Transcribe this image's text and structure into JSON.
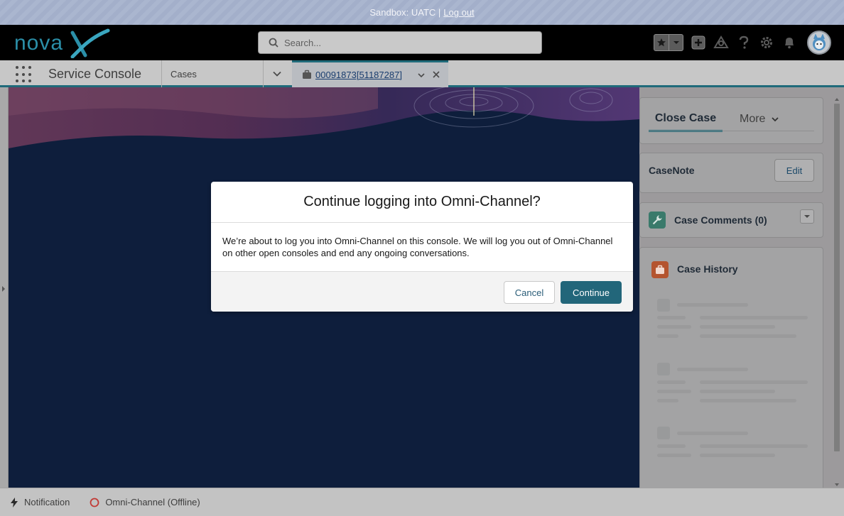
{
  "sandbox_bar": {
    "text": "Sandbox: UATC |",
    "logout_label": "Log out"
  },
  "header": {
    "logo_text": "nova",
    "logo_accent": "X",
    "search_placeholder": "Search...",
    "icons": [
      "star-icon",
      "chevron-down-icon",
      "plus-icon",
      "trailhead-icon",
      "help-icon",
      "gear-icon",
      "bell-icon",
      "avatar"
    ]
  },
  "nav": {
    "app_name": "Service Console",
    "object_label": "Cases",
    "tab_label": "00091873[51187287]"
  },
  "right_panel": {
    "tabs": {
      "active": "Close Case",
      "more": "More"
    },
    "case_note": {
      "title": "CaseNote",
      "edit_label": "Edit"
    },
    "case_comments": {
      "title": "Case Comments (0)"
    },
    "case_history": {
      "title": "Case History"
    }
  },
  "utility_bar": {
    "notification_label": "Notification",
    "omni_label": "Omni-Channel (Offline)"
  },
  "modal": {
    "title": "Continue logging into Omni-Channel?",
    "body": "We’re about to log you into Omni-Channel on this console. We will log you out of Omni-Channel on other open consoles and end any ongoing conversations.",
    "cancel_label": "Cancel",
    "continue_label": "Continue"
  },
  "colors": {
    "brand": "#22667a",
    "omni_offline": "#c23934",
    "comments_icon": "#3a7a6b",
    "history_icon": "#b4542f"
  }
}
